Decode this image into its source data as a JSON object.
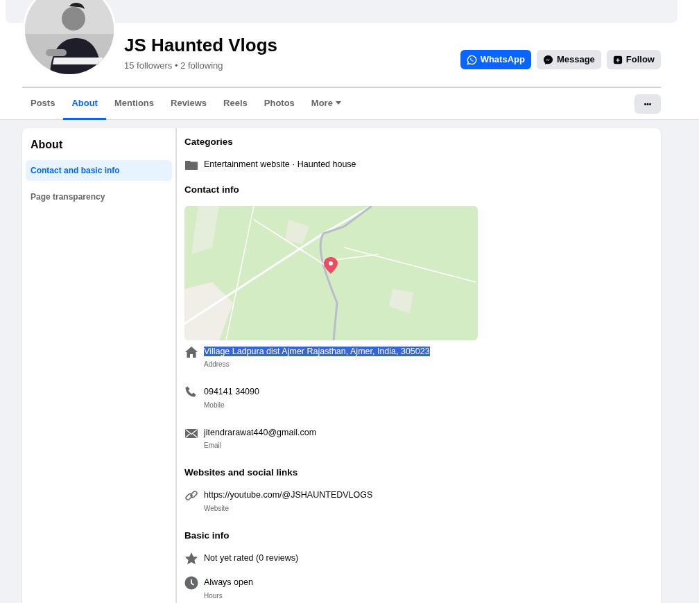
{
  "profile": {
    "name": "JS Haunted Vlogs",
    "stats": "15 followers • 2 following"
  },
  "actions": [
    {
      "label": "WhatsApp",
      "kind": "whatsapp",
      "primary": true
    },
    {
      "label": "Message",
      "kind": "messenger",
      "primary": false
    },
    {
      "label": "Follow",
      "kind": "follow",
      "primary": false
    }
  ],
  "tabs": [
    {
      "label": "Posts",
      "kind": "tab",
      "selected": false
    },
    {
      "label": "About",
      "kind": "tab",
      "selected": true
    },
    {
      "label": "Mentions",
      "kind": "tab",
      "selected": false
    },
    {
      "label": "Reviews",
      "kind": "tab",
      "selected": false
    },
    {
      "label": "Reels",
      "kind": "tab",
      "selected": false
    },
    {
      "label": "Photos",
      "kind": "tab",
      "selected": false
    },
    {
      "label": "More",
      "kind": "dropdown",
      "selected": false
    }
  ],
  "more_button": {
    "label": "•••"
  },
  "about": {
    "title": "About",
    "items": [
      {
        "label": "Contact and basic info",
        "selected": true
      },
      {
        "label": "Page transparency",
        "selected": false
      }
    ]
  },
  "sections": [
    {
      "title": "Categories",
      "entries": [
        {
          "kind": "folder",
          "text": "Entertainment website · Haunted house",
          "highlighted": false
        }
      ]
    },
    {
      "title": "Contact info",
      "map": {
        "kind": "picture"
      },
      "entries": [
        {
          "kind": "home",
          "text": "Village Ladpura dist Ajmer Rajasthan, Ajmer, India, 305023",
          "caption": "Address",
          "highlighted": true
        },
        {
          "kind": "phone",
          "text": "094141 34090",
          "caption": "Mobile",
          "highlighted": false
        },
        {
          "kind": "mail",
          "text": "jitendrarawat440@gmail.com",
          "caption": "Email",
          "highlighted": false
        }
      ]
    },
    {
      "title": "Websites and social links",
      "entries": [
        {
          "kind": "link",
          "text": "https://youtube.com/@JSHAUNTEDVLOGS",
          "caption": "Website",
          "highlighted": false
        }
      ]
    },
    {
      "title": "Basic info",
      "entries": [
        {
          "kind": "star",
          "text": "Not yet rated (0 reviews)",
          "highlighted": false
        },
        {
          "kind": "clock",
          "text": "Always open",
          "caption": "Hours",
          "highlighted": false
        }
      ]
    }
  ]
}
